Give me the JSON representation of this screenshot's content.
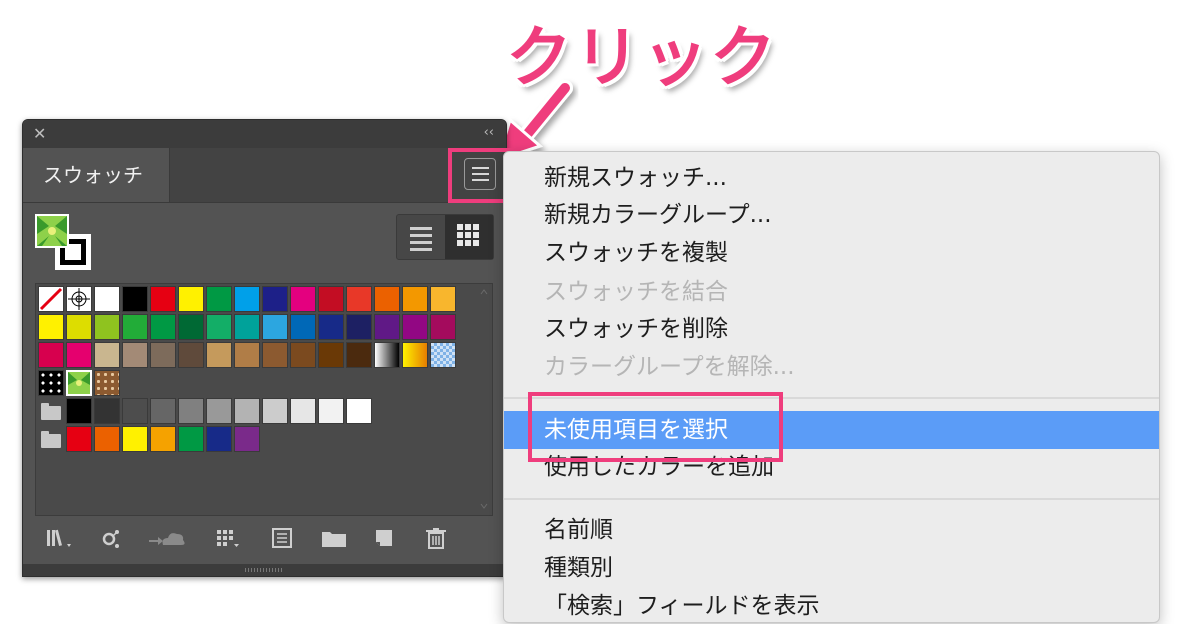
{
  "annotation": {
    "label": "クリック",
    "color": "#ef3d7d"
  },
  "panel": {
    "close_glyph": "✕",
    "collapse_glyph": "‹‹",
    "tab_label": "スウォッチ",
    "menu_button_icon": "hamburger-icon",
    "view_toggle": [
      "list-view-icon",
      "thumbnail-view-icon"
    ],
    "swatch_rows": [
      [
        "none",
        "registration",
        "#ffffff",
        "#000000",
        "#e60012",
        "#fff100",
        "#009944",
        "#00a0e9",
        "#1d2088",
        "#e4007f",
        "#c30d23",
        "#e83828",
        "#eb6100",
        "#f39800",
        "#f8b62d"
      ],
      [
        "#fff100",
        "#dddd00",
        "#8fc31f",
        "#22ac38",
        "#009944",
        "#006934",
        "#13ae67",
        "#00a29a",
        "#2ca6e0",
        "#0068b7",
        "#172a88",
        "#1d2063",
        "#601986",
        "#920783",
        "#a40b5d"
      ],
      [
        "#d7004e",
        "#e5006e",
        "#c9b68f",
        "#a38a76",
        "#7d6b5b",
        "#5f4a3b",
        "#c59a5c",
        "#b07d47",
        "#8c5a30",
        "#7b4a1f",
        "#6a3906",
        "#4b2a0e",
        "gradient-bw",
        "gradient-yellow",
        "gradient-blue"
      ],
      [
        "pattern-dots",
        "pattern-leaf",
        "pattern-brown"
      ]
    ],
    "gray_group": [
      "#000000",
      "#333333",
      "#4d4d4d",
      "#666666",
      "#808080",
      "#999999",
      "#b3b3b3",
      "#cccccc",
      "#e6e6e6",
      "#f2f2f2",
      "#ffffff"
    ],
    "color_group": [
      "#e60012",
      "#eb6100",
      "#fff100",
      "#f5a200",
      "#009944",
      "#172a88",
      "#7a2a8a"
    ],
    "bottom_icons": [
      "library-icon",
      "swatch-kinds-icon",
      "cloud-icon",
      "swatch-options-icon",
      "new-color-group-icon",
      "folder-icon",
      "new-swatch-icon",
      "trash-icon"
    ]
  },
  "menu": {
    "items": [
      {
        "label": "新規スウォッチ...",
        "enabled": true
      },
      {
        "label": "新規カラーグループ...",
        "enabled": true
      },
      {
        "label": "スウォッチを複製",
        "enabled": true
      },
      {
        "label": "スウォッチを結合",
        "enabled": false
      },
      {
        "label": "スウォッチを削除",
        "enabled": true
      },
      {
        "label": "カラーグループを解除...",
        "enabled": false
      },
      {
        "label": "未使用項目を選択",
        "enabled": true,
        "selected": true
      },
      {
        "label": "使用したカラーを追加",
        "enabled": true
      },
      {
        "label": "名前順",
        "enabled": true
      },
      {
        "label": "種類別",
        "enabled": true
      },
      {
        "label": "「検索」フィールドを表示",
        "enabled": true
      }
    ],
    "highlight_color": "#5b9cf7"
  }
}
